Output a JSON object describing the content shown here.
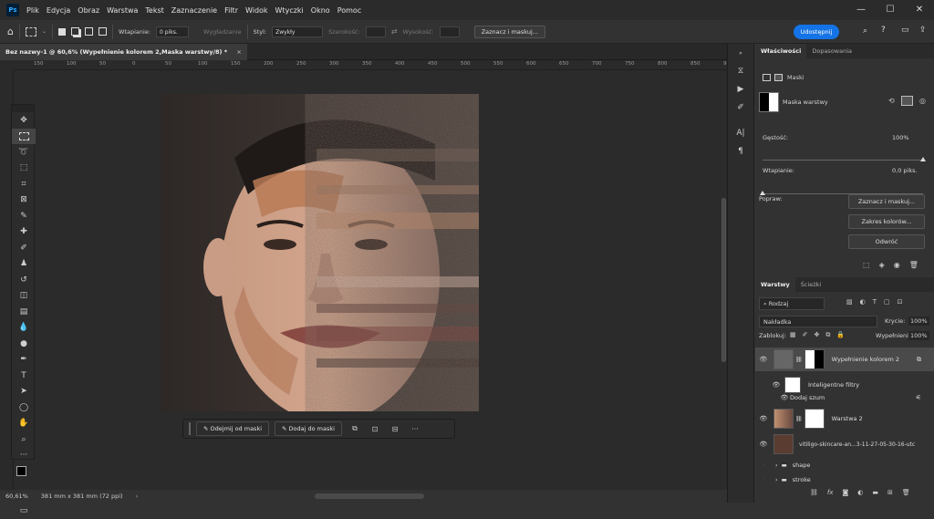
{
  "app": {
    "logo": "Ps"
  },
  "menu": [
    "Plik",
    "Edycja",
    "Obraz",
    "Warstwa",
    "Tekst",
    "Zaznaczenie",
    "Filtr",
    "Widok",
    "Wtyczki",
    "Okno",
    "Pomoc"
  ],
  "window_controls": {
    "minimize": "—",
    "maximize": "☐",
    "close": "✕"
  },
  "options": {
    "feather_label": "Wtapianie:",
    "feather_value": "0 piks.",
    "antialias_label": "Wygładzanie",
    "style_label": "Styl:",
    "style_value": "Zwykły",
    "width_label": "Szerokość:",
    "height_label": "Wysokość:",
    "select_mask_button": "Zaznacz i maskuj...",
    "share_button": "Udostępnij"
  },
  "document_tab": {
    "title": "Bez nazwy-1 @ 60,6% (Wypełnienie kolorem 2,Maska warstwy/8) *",
    "close": "×"
  },
  "ruler_h": [
    "150",
    "100",
    "50",
    "0",
    "50",
    "100",
    "150",
    "200",
    "250",
    "300",
    "350",
    "400",
    "450",
    "500",
    "550",
    "600",
    "650",
    "700",
    "750",
    "800",
    "850",
    "900"
  ],
  "context_bar": {
    "subtract_label": "Odejmij od maski",
    "add_label": "Dodaj do maski",
    "more": "···"
  },
  "status": {
    "zoom": "60,61%",
    "doc_size": "381 mm x 381 mm (72 ppi)"
  },
  "properties": {
    "tabs": [
      "Właściwości",
      "Dopasowania"
    ],
    "section_label": "Maski",
    "mask_label": "Maska warstwy",
    "density_label": "Gęstość:",
    "density_value": "100%",
    "density_fraction": 1.0,
    "feather_label": "Wtapianie:",
    "feather_value": "0,0 piks.",
    "feather_fraction": 0.0,
    "refine_label": "Popraw:",
    "btn_select_mask": "Zaznacz i maskuj...",
    "btn_color_range": "Zakres kolorów...",
    "btn_invert": "Odwróć"
  },
  "layers_panel": {
    "tabs": [
      "Warstwy",
      "Ścieżki"
    ],
    "filter_label": "Rodzaj",
    "blend_mode": "Nakładka",
    "opacity_label": "Krycie:",
    "opacity_value": "100%",
    "lock_label": "Zablokuj:",
    "fill_label": "Wypełnienie:",
    "fill_value": "100%",
    "layers": [
      {
        "name": "Wypełnienie kolorem 2",
        "selected": true
      },
      {
        "name": "Inteligentne filtry",
        "sub": true
      },
      {
        "name": "Dodaj szum",
        "sub": true
      },
      {
        "name": "Warstwa 2"
      },
      {
        "name": "vitiligo-skincare-an...3-11-27-05-30-16-utc"
      },
      {
        "name": "shape",
        "group": true
      },
      {
        "name": "stroke",
        "group": true
      }
    ],
    "footer_icons": [
      "link-icon",
      "fx-icon",
      "mask-icon",
      "adjustment-icon",
      "folder-icon",
      "new-layer-icon",
      "trash-icon"
    ]
  },
  "colors": {
    "accent": "#1473e6",
    "panel": "#323232",
    "workspace": "#2b2b2b"
  }
}
